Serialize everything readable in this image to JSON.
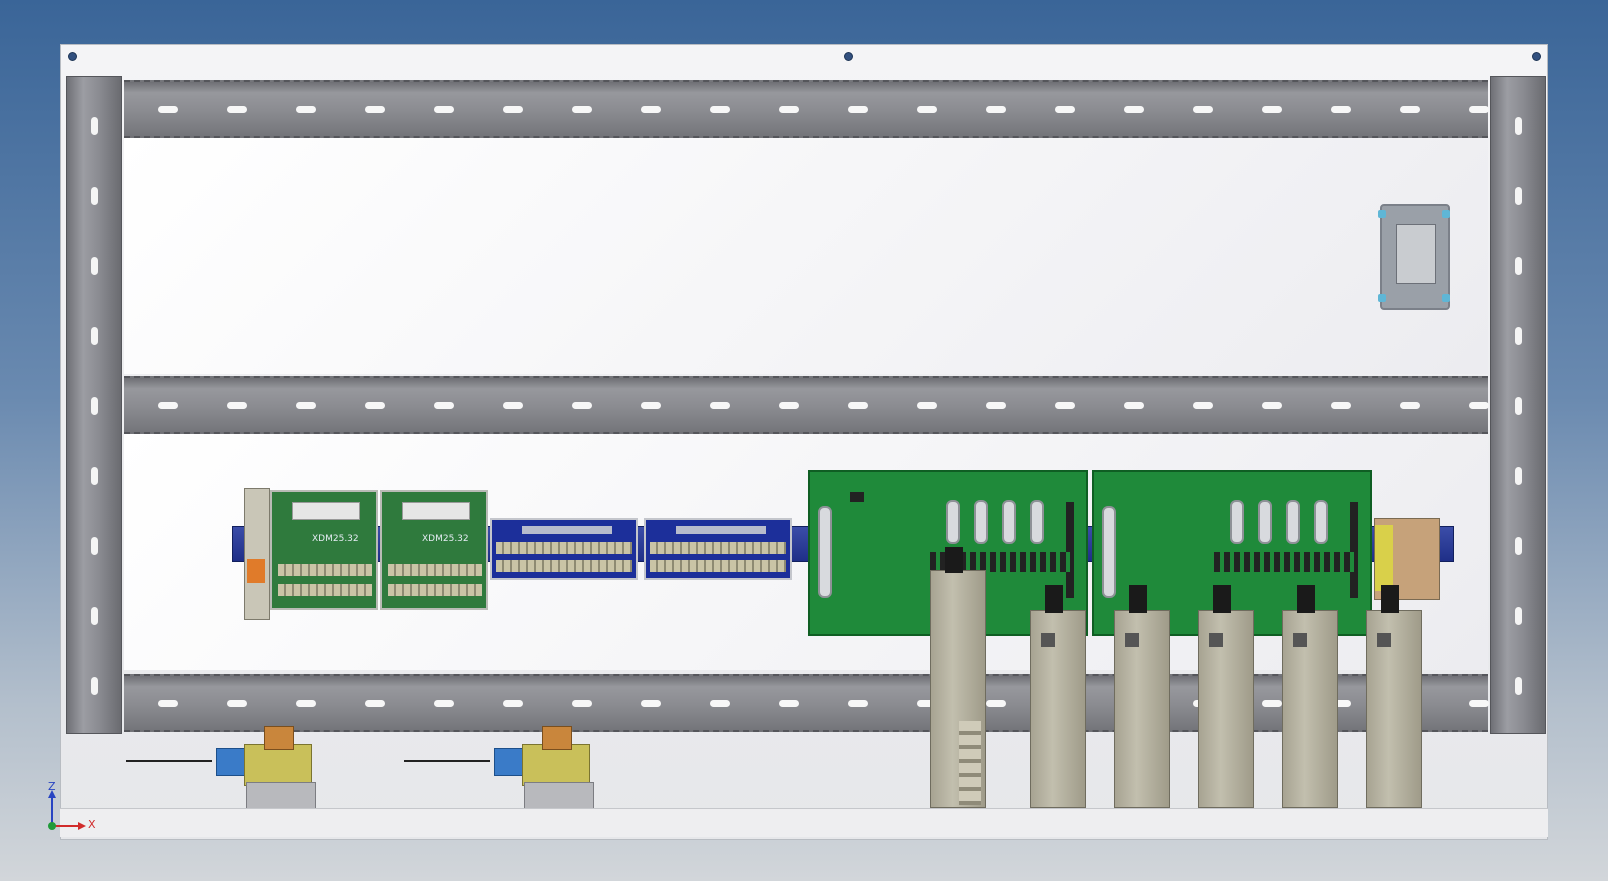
{
  "scene": {
    "description_visible_text": {
      "terminal_module_1": "XDM25.32",
      "terminal_module_2": "XDM25.32"
    },
    "axis": {
      "z_label": "Z",
      "x_label": "X"
    },
    "colors": {
      "background_top": "#3a6598",
      "panel": "#f0f0f2",
      "rail": "#8a8b90",
      "pcb_green": "#1f8a3a",
      "terminal_green": "#2f7a3d",
      "terminal_blue": "#1c2f9a",
      "drive_body": "#b4b09e",
      "axis_z": "#2744c2",
      "axis_x": "#d12b2b",
      "axis_origin": "#1f9a3a"
    },
    "icons": {
      "drives": [
        "servo-drive-icon",
        "servo-drive-icon",
        "servo-drive-icon",
        "servo-drive-icon",
        "servo-drive-icon",
        "servo-drive-icon"
      ],
      "valves": [
        "pneumatic-valve-icon",
        "pneumatic-valve-icon"
      ],
      "filter": "emi-filter-icon"
    }
  }
}
